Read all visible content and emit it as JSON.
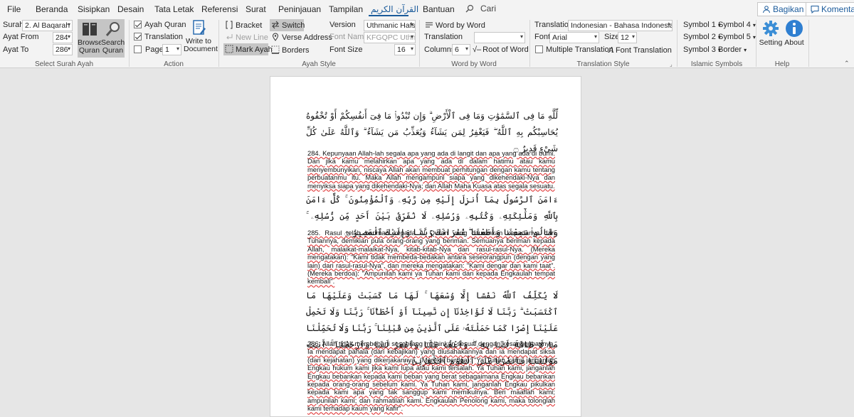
{
  "tabs": {
    "file": "File",
    "home": "Beranda",
    "insert": "Sisipkan",
    "design": "Desain",
    "layout": "Tata Letak",
    "references": "Referensi",
    "mailings": "Surat",
    "review": "Peninjauan",
    "view": "Tampilan",
    "quran": "القرآن الكريم",
    "help": "Bantuan",
    "tellme": "Cari"
  },
  "topright": {
    "share": "Bagikan",
    "comments": "Komentar"
  },
  "select_surah": {
    "surah_label": "Surah",
    "surah_value": "2. Al Baqarah",
    "from_label": "Ayat From",
    "from_value": "284",
    "to_label": "Ayat To",
    "to_value": "286",
    "browse_label": "Browse Quran",
    "search_label": "Search Quran",
    "group": "Select Surah  Ayah"
  },
  "action": {
    "ayah_quran": "Ayah Quran",
    "translation": "Translation",
    "page": "Page",
    "page_value": "1",
    "write": "Write to Document",
    "group": "Action"
  },
  "ayah_style": {
    "bracket": "Bracket",
    "new_line": "New Line",
    "mark_ayah": "Mark Ayah",
    "switch": "Switch",
    "verse_address": "Verse Address",
    "borders": "Borders",
    "version_label": "Version",
    "version_value": "Uthmanic Hafs",
    "font_name_label": "Font Name",
    "font_name_value": "KFGQPC Uthm",
    "font_size_label": "Font Size",
    "font_size_value": "16",
    "group": "Ayah Style"
  },
  "word_by_word": {
    "word_by_word": "Word by Word",
    "translation_label": "Translation",
    "columns_label": "Columns",
    "columns_value": "6",
    "root": "Root of Word",
    "group": "Word by Word"
  },
  "translation_style": {
    "translation_label": "Translation",
    "translation_value": "Indonesian - Bahasa Indonesia",
    "font_label": "Font",
    "font_value": "Arial",
    "size_label": "Size",
    "size_value": "12",
    "multiple": "Multiple Translation",
    "font_translation": "Font Translation",
    "group": "Translation Style"
  },
  "islamic_symbols": {
    "s1": "Symbol 1",
    "s2": "Symbol 2",
    "s3": "Symbol 3",
    "s4": "Symbol 4",
    "s5": "Symbol 5",
    "border": "Border",
    "group": "Islamic Symbols"
  },
  "help": {
    "setting": "Setting",
    "about": "About",
    "group": "Help"
  },
  "document": {
    "ayah284_ar": "لِّلَّهِ مَا فِى ٱلسَّمَٰوَٰتِ وَمَا فِى ٱلْأَرْضِ ۗ وَإِن تُبْدُوا۟ مَا فِىٓ أَنفُسِكُمْ أَوْ تُخْفُوهُ يُحَاسِبْكُم بِهِ ٱللَّهُ ۖ فَيَغْفِرُ لِمَن يَشَآءُ وَيُعَذِّبُ مَن يَشَآءُ ۗ وَٱللَّهُ عَلَىٰ كُلِّ شَىْءٍ قَدِيرٌ ۝",
    "ayah284_tr": "284. Kepunyaan Allah-lah segala apa yang ada di langit dan apa yang ada di bumi. Dan jika kamu melahirkan apa yang ada di dalam hatimu atau kamu menyembunyikan, niscaya Allah akan membuat perhitungan dengan kamu tentang perbuatanmu itu. Maka Allah mengampuni siapa yang dikehendaki-Nya dan menyiksa siapa yang dikehendaki-Nya; dan Allah Maha Kuasa atas segala sesuatu.",
    "ayah285_ar": "ءَامَنَ ٱلرَّسُولُ بِمَآ أُنزِلَ إِلَيْهِ مِن رَّبِّهِۦ وَٱلْمُؤْمِنُونَ ۚ كُلٌّ ءَامَنَ بِٱللَّهِ وَمَلَٰٓئِكَتِهِۦ وَكُتُبِهِۦ وَرُسُلِهِۦ لَا نُفَرِّقُ بَيْنَ أَحَدٍ مِّن رُّسُلِهِۦ ۚ وَقَالُوا۟ سَمِعْنَا وَأَطَعْنَا ۖ غُفْرَانَكَ رَبَّنَا وَإِلَيْكَ ٱلْمَصِيرُ ۝",
    "ayah285_tr": "285. Rasul telah beriman kepada Al Quran yang diturunkan kepadanya dari Tuhannya, demikian pula orang-orang yang beriman. Semuanya beriman kepada Allah, malaikat-malaikat-Nya, kitab-kitab-Nya dan rasul-rasul-Nya. (Mereka mengatakan): \"Kami tidak membeda-bedakan antara seseorangpun (dengan yang lain) dari rasul-rasul-Nya\", dan mereka mengatakan: \"Kami dengar dan kami taat\". (Mereka berdoa): \"Ampunilah kami ya Tuhan kami dan kepada Engkaulah tempat kembali\".",
    "ayah286_ar": "لَا يُكَلِّفُ ٱللَّهُ نَفْسًا إِلَّا وُسْعَهَا ۚ لَهَا مَا كَسَبَتْ وَعَلَيْهَا مَا ٱكْتَسَبَتْ ۗ رَبَّنَا لَا تُؤَاخِذْنَآ إِن نَّسِينَآ أَوْ أَخْطَأْنَا ۚ رَبَّنَا وَلَا تَحْمِلْ عَلَيْنَآ إِصْرًا كَمَا حَمَلْتَهُۥ عَلَى ٱلَّذِينَ مِن قَبْلِنَا ۚ رَبَّنَا وَلَا تُحَمِّلْنَا مَا لَا طَاقَةَ لَنَا بِهِۦ ۖ وَٱعْفُ عَنَّا وَٱغْفِرْ لَنَا وَٱرْحَمْنَآ ۚ أَنتَ مَوْلَىٰنَا فَٱنصُرْنَا عَلَى ٱلْقَوْمِ ٱلْكَٰفِرِينَ ۝",
    "ayah286_tr": "286. Allah tidak membebani seseorang melainkan sesuai dengan kesanggupannya. Ia mendapat pahala (dari kebajikan) yang diusahakannya dan ia mendapat siksa (dari kejahatan) yang dikerjakannya. (Mereka berdoa): \"Ya Tuhan kami, janganlah Engkau hukum kami jika kami lupa atau kami tersalah. Ya Tuhan kami, janganlah Engkau bebankan kepada kami beban yang berat sebagaimana Engkau bebankan kepada orang-orang sebelum kami. Ya Tuhan kami, janganlah Engkau pikulkan kepada kami apa yang tak sanggup kami memikulnya. Beri maaflah kami; ampunilah kami; dan rahmatilah kami. Engkaulah Penolong kami, maka tolonglah kami terhadap kaum yang kafir\"."
  }
}
